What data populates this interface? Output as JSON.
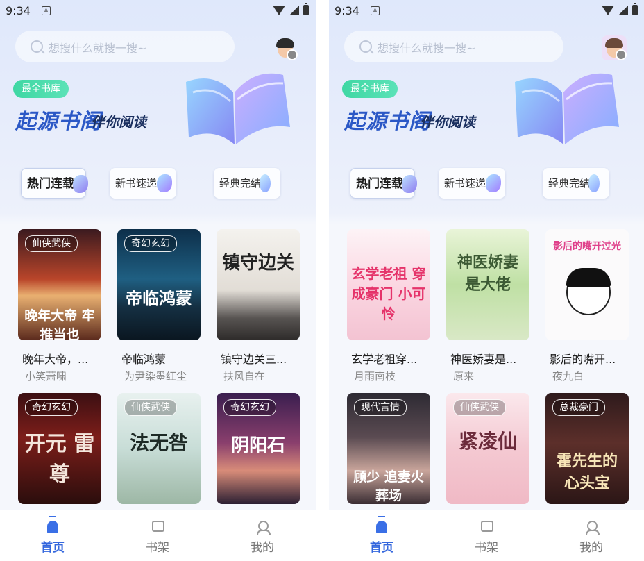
{
  "status": {
    "time": "9:34",
    "notif": "A"
  },
  "search": {
    "placeholder": "想搜什么就搜一搜~"
  },
  "hero": {
    "tag": "最全书库",
    "brand": "起源书阁",
    "slogan": "伴你阅读"
  },
  "categories": [
    "热门连载",
    "新书速递",
    "经典完结"
  ],
  "colors": {
    "accent": "#3366dd",
    "tag_green": "#4bdcaa",
    "brand_blue": "#2b58c6"
  },
  "nav": [
    "首页",
    "书架",
    "我的"
  ],
  "screens": [
    {
      "books": [
        {
          "tag": "仙侠武侠",
          "cover_text": "晚年大帝 牢推当也",
          "title": "晚年大帝，...",
          "author": "小笑萧啸"
        },
        {
          "tag": "奇幻玄幻",
          "cover_text": "帝临鸿蒙",
          "title": "帝临鸿蒙",
          "author": "为尹染墨红尘"
        },
        {
          "tag": "",
          "cover_text": "镇守边关",
          "title": "镇守边关三...",
          "author": "扶风自在"
        },
        {
          "tag": "奇幻玄幻",
          "cover_text": "开元 雷尊",
          "title": "",
          "author": ""
        },
        {
          "tag": "仙侠武侠",
          "cover_text": "法无咎",
          "title": "",
          "author": ""
        },
        {
          "tag": "奇幻玄幻",
          "cover_text": "阴阳石",
          "title": "",
          "author": ""
        }
      ]
    },
    {
      "books": [
        {
          "tag": "",
          "cover_text": "玄学老祖 穿成豪门 小可怜",
          "title": "玄学老祖穿...",
          "author": "月雨南枝"
        },
        {
          "tag": "",
          "cover_text": "神医娇妻 是大佬",
          "title": "神医娇妻是...",
          "author": "原来"
        },
        {
          "tag": "",
          "cover_text": "影后的嘴开过光",
          "title": "影后的嘴开...",
          "author": "夜九白"
        },
        {
          "tag": "现代言情",
          "cover_text": "顾少 追妻火葬场",
          "title": "",
          "author": ""
        },
        {
          "tag": "仙侠武侠",
          "cover_text": "紧凌仙",
          "title": "",
          "author": ""
        },
        {
          "tag": "总裁豪门",
          "cover_text": "霍先生的 心头宝",
          "title": "",
          "author": ""
        }
      ]
    }
  ]
}
